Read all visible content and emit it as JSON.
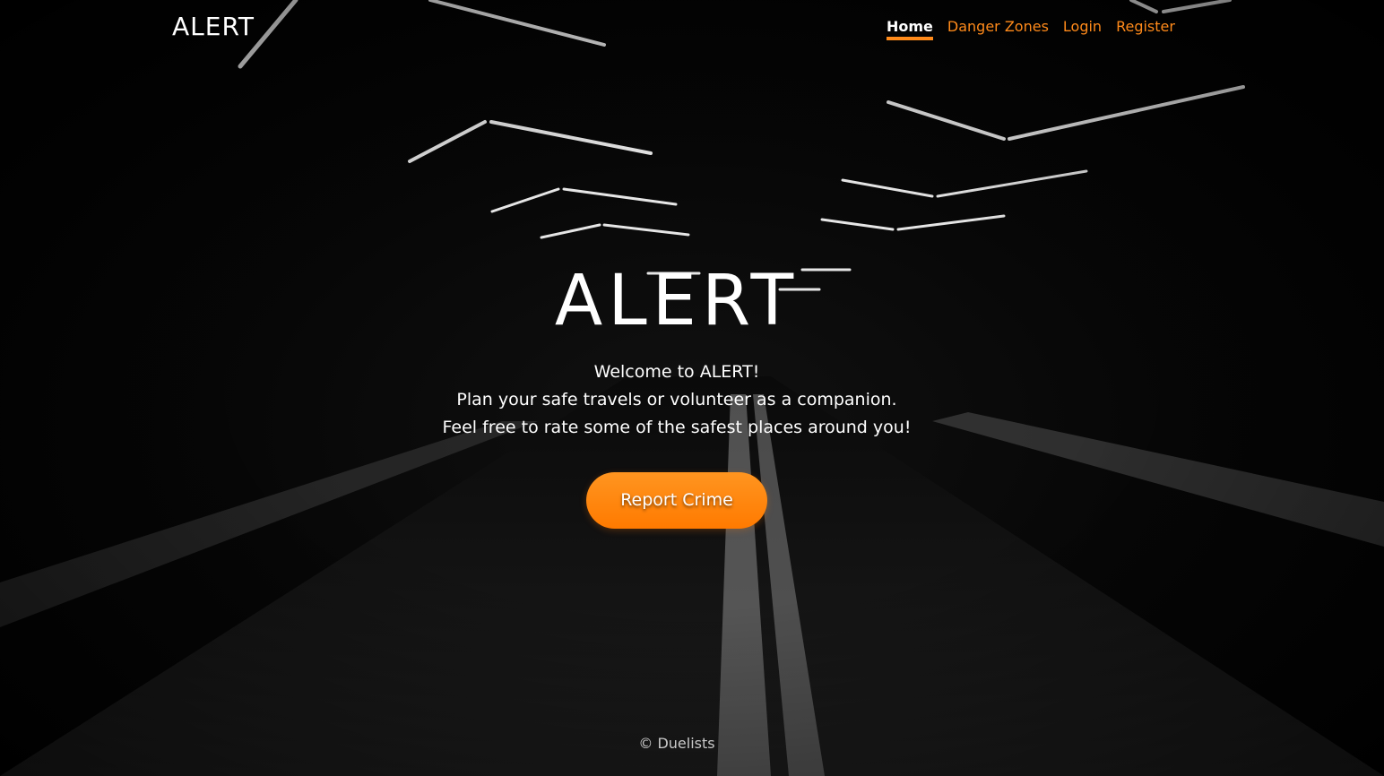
{
  "navbar": {
    "brand": "ALERT",
    "links": [
      {
        "label": "Home",
        "active": true
      },
      {
        "label": "Danger Zones",
        "active": false
      },
      {
        "label": "Login",
        "active": false
      },
      {
        "label": "Register",
        "active": false
      }
    ]
  },
  "hero": {
    "title": "ALERT",
    "lines": [
      "Welcome to ALERT!",
      "Plan your safe travels or volunteer as a companion.",
      "Feel free to rate some of the safest places around you!"
    ],
    "cta_label": "Report Crime"
  },
  "footer": {
    "text": "© Duelists"
  },
  "colors": {
    "accent": "#ff8a1a",
    "text": "#ffffff",
    "background": "#000000"
  }
}
